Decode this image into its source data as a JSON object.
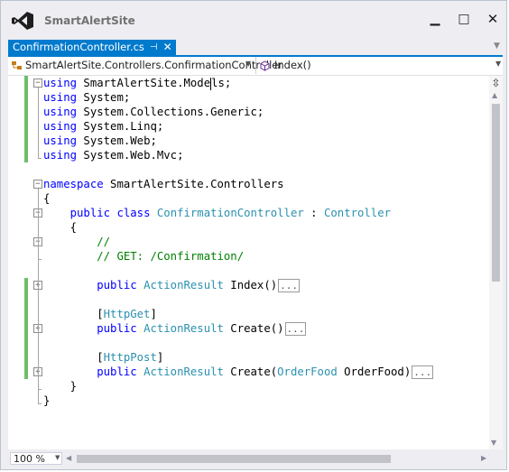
{
  "window": {
    "title": "SmartAlertSite",
    "minimize_glyph": "▁",
    "maximize_glyph": "□",
    "close_glyph": "✕"
  },
  "tab": {
    "label": "ConfirmationController.cs",
    "pin_glyph": "⊣",
    "close_glyph": "✕"
  },
  "navbar": {
    "type_selector": "SmartAlertSite.Controllers.ConfirmationController",
    "member_selector": "Index()"
  },
  "code": {
    "lines": [
      "using SmartAlertSite.Models;",
      "using System;",
      "using System.Collections.Generic;",
      "using System.Linq;",
      "using System.Web;",
      "using System.Web.Mvc;",
      "",
      "namespace SmartAlertSite.Controllers",
      "{",
      "    public class ConfirmationController : Controller",
      "    {",
      "        //",
      "        // GET: /Confirmation/",
      "",
      "        public ActionResult Index()...",
      "",
      "        [HttpGet]",
      "        public ActionResult Create()...",
      "",
      "        [HttpPost]",
      "        public ActionResult Create(OrderFood OrderFood)...",
      "    }",
      "}"
    ]
  },
  "status": {
    "zoom": "100 %"
  },
  "colors": {
    "accent": "#007acc",
    "keyword": "#0000ff",
    "type": "#2b91af",
    "comment": "#008000",
    "change_bar": "#6cbf6a"
  },
  "icons": [
    "visual-studio-logo-icon",
    "class-icon",
    "method-icon",
    "split-handle-icon"
  ]
}
